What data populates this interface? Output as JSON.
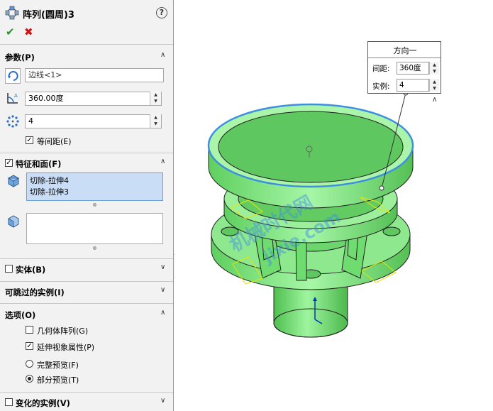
{
  "header": {
    "title": "阵列(圆周)3",
    "help_icon": "?",
    "ok_icon": "✔",
    "cancel_icon": "✖"
  },
  "params": {
    "title": "参数(P)",
    "direction_value": "边线<1>",
    "angle_value": "360.00度",
    "instances_value": "4",
    "equal_spacing_label": "等间距(E)",
    "equal_spacing_checked": true
  },
  "features": {
    "title": "特征和面(F)",
    "checked": true,
    "items": [
      "切除-拉伸4",
      "切除-拉伸3"
    ]
  },
  "bodies": {
    "title": "实体(B)",
    "checked": false
  },
  "skip": {
    "title": "可跳过的实例(I)"
  },
  "options": {
    "title": "选项(O)",
    "geometry_pattern_label": "几何体阵列(G)",
    "geometry_pattern_checked": false,
    "propagate_label": "延伸视象属性(P)",
    "propagate_checked": true,
    "full_preview_label": "完整预览(F)",
    "partial_preview_label": "部分预览(T)",
    "preview_mode": "partial"
  },
  "varied": {
    "title": "变化的实例(V)"
  },
  "callout": {
    "title": "方向一",
    "spacing_label": "间距:",
    "spacing_value": "360度",
    "instances_label": "实例:",
    "instances_value": "4"
  },
  "watermark": {
    "line1": "机械时代网",
    "line2": "jixie.com"
  },
  "colors": {
    "model_green": "#7de87d",
    "selection_blue": "#3d8fe0",
    "panel_bg": "#f2f2f2"
  }
}
